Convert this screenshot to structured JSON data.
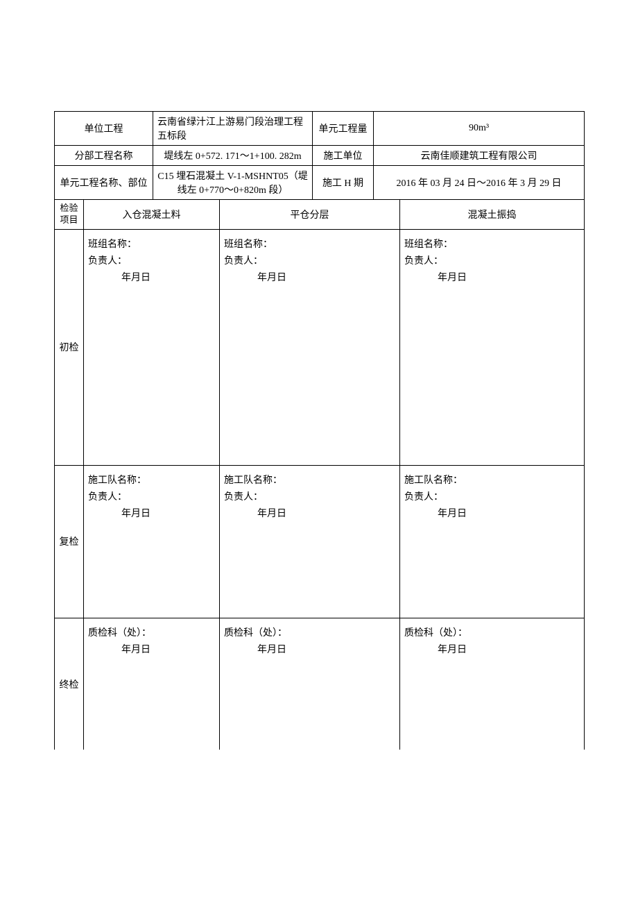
{
  "header": {
    "unit_project_label": "单位工程",
    "unit_project_value": "云南省绿汁江上游易门段治理工程五标段",
    "unit_qty_label": "单元工程量",
    "unit_qty_value": "90m³",
    "sub_project_label": "分部工程名称",
    "sub_project_value": "堤线左 0+572. 171～1+100. 282m",
    "construction_unit_label": "施工单位",
    "construction_unit_value": "云南佳顺建筑工程有限公司",
    "unit_part_label": "单元工程名称、部位",
    "unit_part_value": "C15 埋石混凝土 V-1-MSHNT05（堤线左 0+770～0+820m 段）",
    "period_label": "施工 H 期",
    "period_value": "2016 年 03 月 24 日～2016 年 3 月 29 日"
  },
  "check_row": {
    "label": "检验项目",
    "col1": "入仓混凝土料",
    "col2": "平仓分层",
    "col3": "混凝土振捣"
  },
  "rows": {
    "initial": {
      "label": "初检",
      "team_label": "班组名称：",
      "person_label": "负责人：",
      "date_label": "年月日"
    },
    "recheck": {
      "label": "复检",
      "team_label": "施工队名称：",
      "person_label": "负责人：",
      "date_label": "年月日"
    },
    "final": {
      "label": "终检",
      "dept_label": "质检科（处）：",
      "date_label": "年月日"
    }
  }
}
